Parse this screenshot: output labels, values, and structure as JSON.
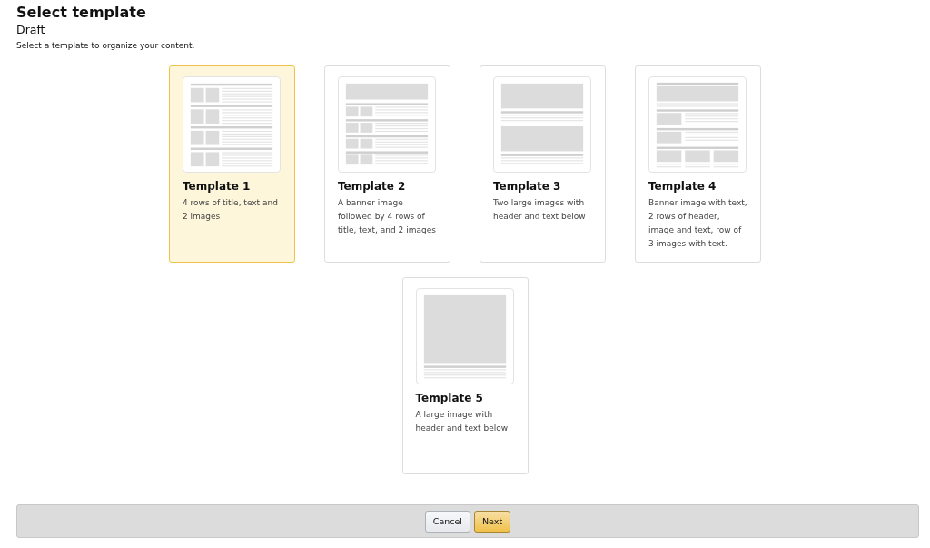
{
  "header": {
    "title": "Select template",
    "subtitle": "Draft",
    "instructions": "Select a template to organize your content."
  },
  "templates": [
    {
      "kind": "rows",
      "title": "Template 1",
      "description": "4 rows of title, text and 2 images",
      "selected": true
    },
    {
      "kind": "banner-rows",
      "title": "Template 2",
      "description": "A banner image followed by 4 rows of title, text, and 2 images",
      "selected": false
    },
    {
      "kind": "two-images",
      "title": "Template 3",
      "description": "Two large images with header and text below",
      "selected": false
    },
    {
      "kind": "mixed",
      "title": "Template 4",
      "description": "Banner image with text, 2 rows of header, image and text, row of 3 images with text.",
      "selected": false
    },
    {
      "kind": "single-image",
      "title": "Template 5",
      "description": "A large image with header and text below",
      "selected": false
    }
  ],
  "footer": {
    "buttons": [
      {
        "kind": "secondary",
        "label": "Cancel"
      },
      {
        "kind": "primary",
        "label": "Next"
      }
    ]
  }
}
